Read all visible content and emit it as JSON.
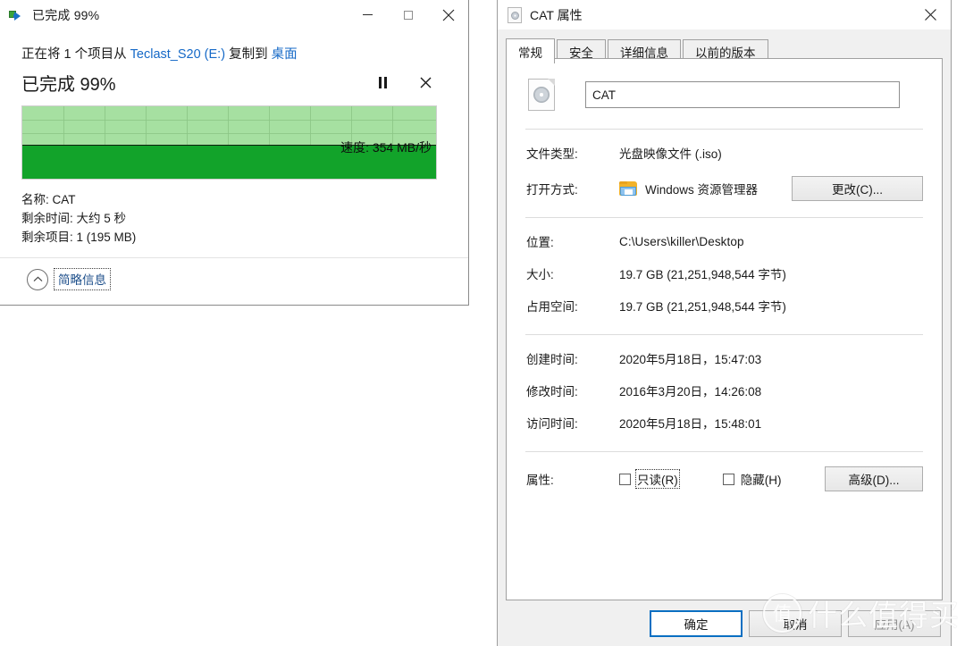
{
  "copy_dialog": {
    "title": "已完成 99%",
    "icon": "copy-icon",
    "minimize_label": "最小化",
    "maximize_label": "最大化",
    "close_label": "关闭",
    "line1_prefix": "正在将 1 个项目从 ",
    "line1_source": "Teclast_S20 (E:)",
    "line1_middle": " 复制到 ",
    "line1_dest": "桌面",
    "percent_text": "已完成 99%",
    "pause_label": "暂停",
    "cancel_label": "取消",
    "speed_text": "速度: 354 MB/秒",
    "details": {
      "name": "名称: CAT",
      "time_remaining": "剩余时间: 大约 5 秒",
      "items_remaining": "剩余项目: 1 (195 MB)"
    },
    "less_info_label": "简略信息"
  },
  "properties_dialog": {
    "title": "CAT 属性",
    "close_label": "关闭",
    "tabs": [
      {
        "label": "常规",
        "active": true
      },
      {
        "label": "安全",
        "active": false
      },
      {
        "label": "详细信息",
        "active": false
      },
      {
        "label": "以前的版本",
        "active": false
      }
    ],
    "file_name": "CAT",
    "fields": {
      "file_type_label": "文件类型:",
      "file_type_value": "光盘映像文件 (.iso)",
      "open_with_label": "打开方式:",
      "open_with_value": "Windows 资源管理器",
      "change_button": "更改(C)...",
      "location_label": "位置:",
      "location_value": "C:\\Users\\killer\\Desktop",
      "size_label": "大小:",
      "size_value": "19.7 GB (21,251,948,544 字节)",
      "size_on_disk_label": "占用空间:",
      "size_on_disk_value": "19.7 GB (21,251,948,544 字节)",
      "created_label": "创建时间:",
      "created_value": "2020年5月18日，15:47:03",
      "modified_label": "修改时间:",
      "modified_value": "2016年3月20日，14:26:08",
      "accessed_label": "访问时间:",
      "accessed_value": "2020年5月18日，15:48:01",
      "attributes_label": "属性:",
      "readonly_label": "只读(R)",
      "hidden_label": "隐藏(H)",
      "advanced_button": "高级(D)..."
    },
    "footer": {
      "ok": "确定",
      "cancel": "取消",
      "apply": "应用(A)"
    }
  },
  "watermark": {
    "logo_char": "值",
    "text": "什么值得买"
  },
  "colors": {
    "accent_blue": "#0a6fc2",
    "link_blue": "#1569c7",
    "progress_fill": "#12a32a",
    "progress_bg": "#a6e0a1"
  }
}
